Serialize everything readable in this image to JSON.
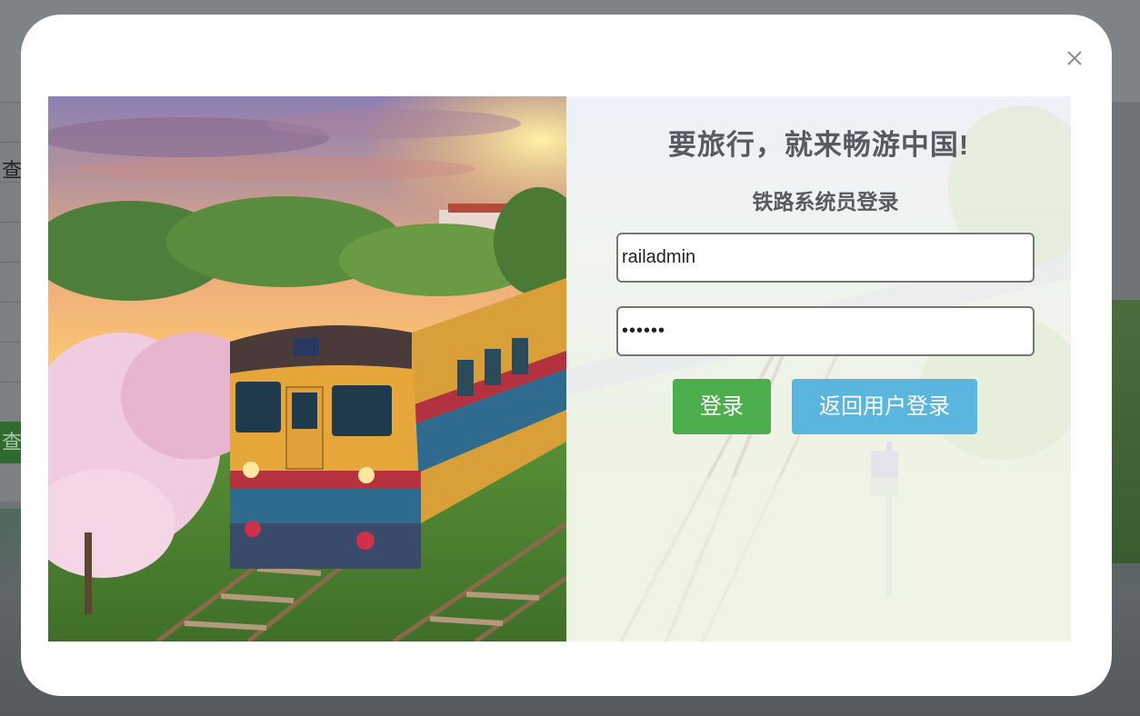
{
  "backdrop": {
    "side_char": "查",
    "side_button": "查"
  },
  "modal": {
    "close_icon": "close-icon",
    "illustration": "train-illustration",
    "title": "要旅行，就来畅游中国!",
    "subtitle": "铁路系统员登录",
    "username": {
      "value": "railadmin"
    },
    "password": {
      "value": "••••••"
    },
    "login_button": "登录",
    "back_button": "返回用户登录"
  },
  "colors": {
    "login_green": "#4cae4c",
    "back_blue": "#5bb6df",
    "title_gray": "#555b60"
  }
}
